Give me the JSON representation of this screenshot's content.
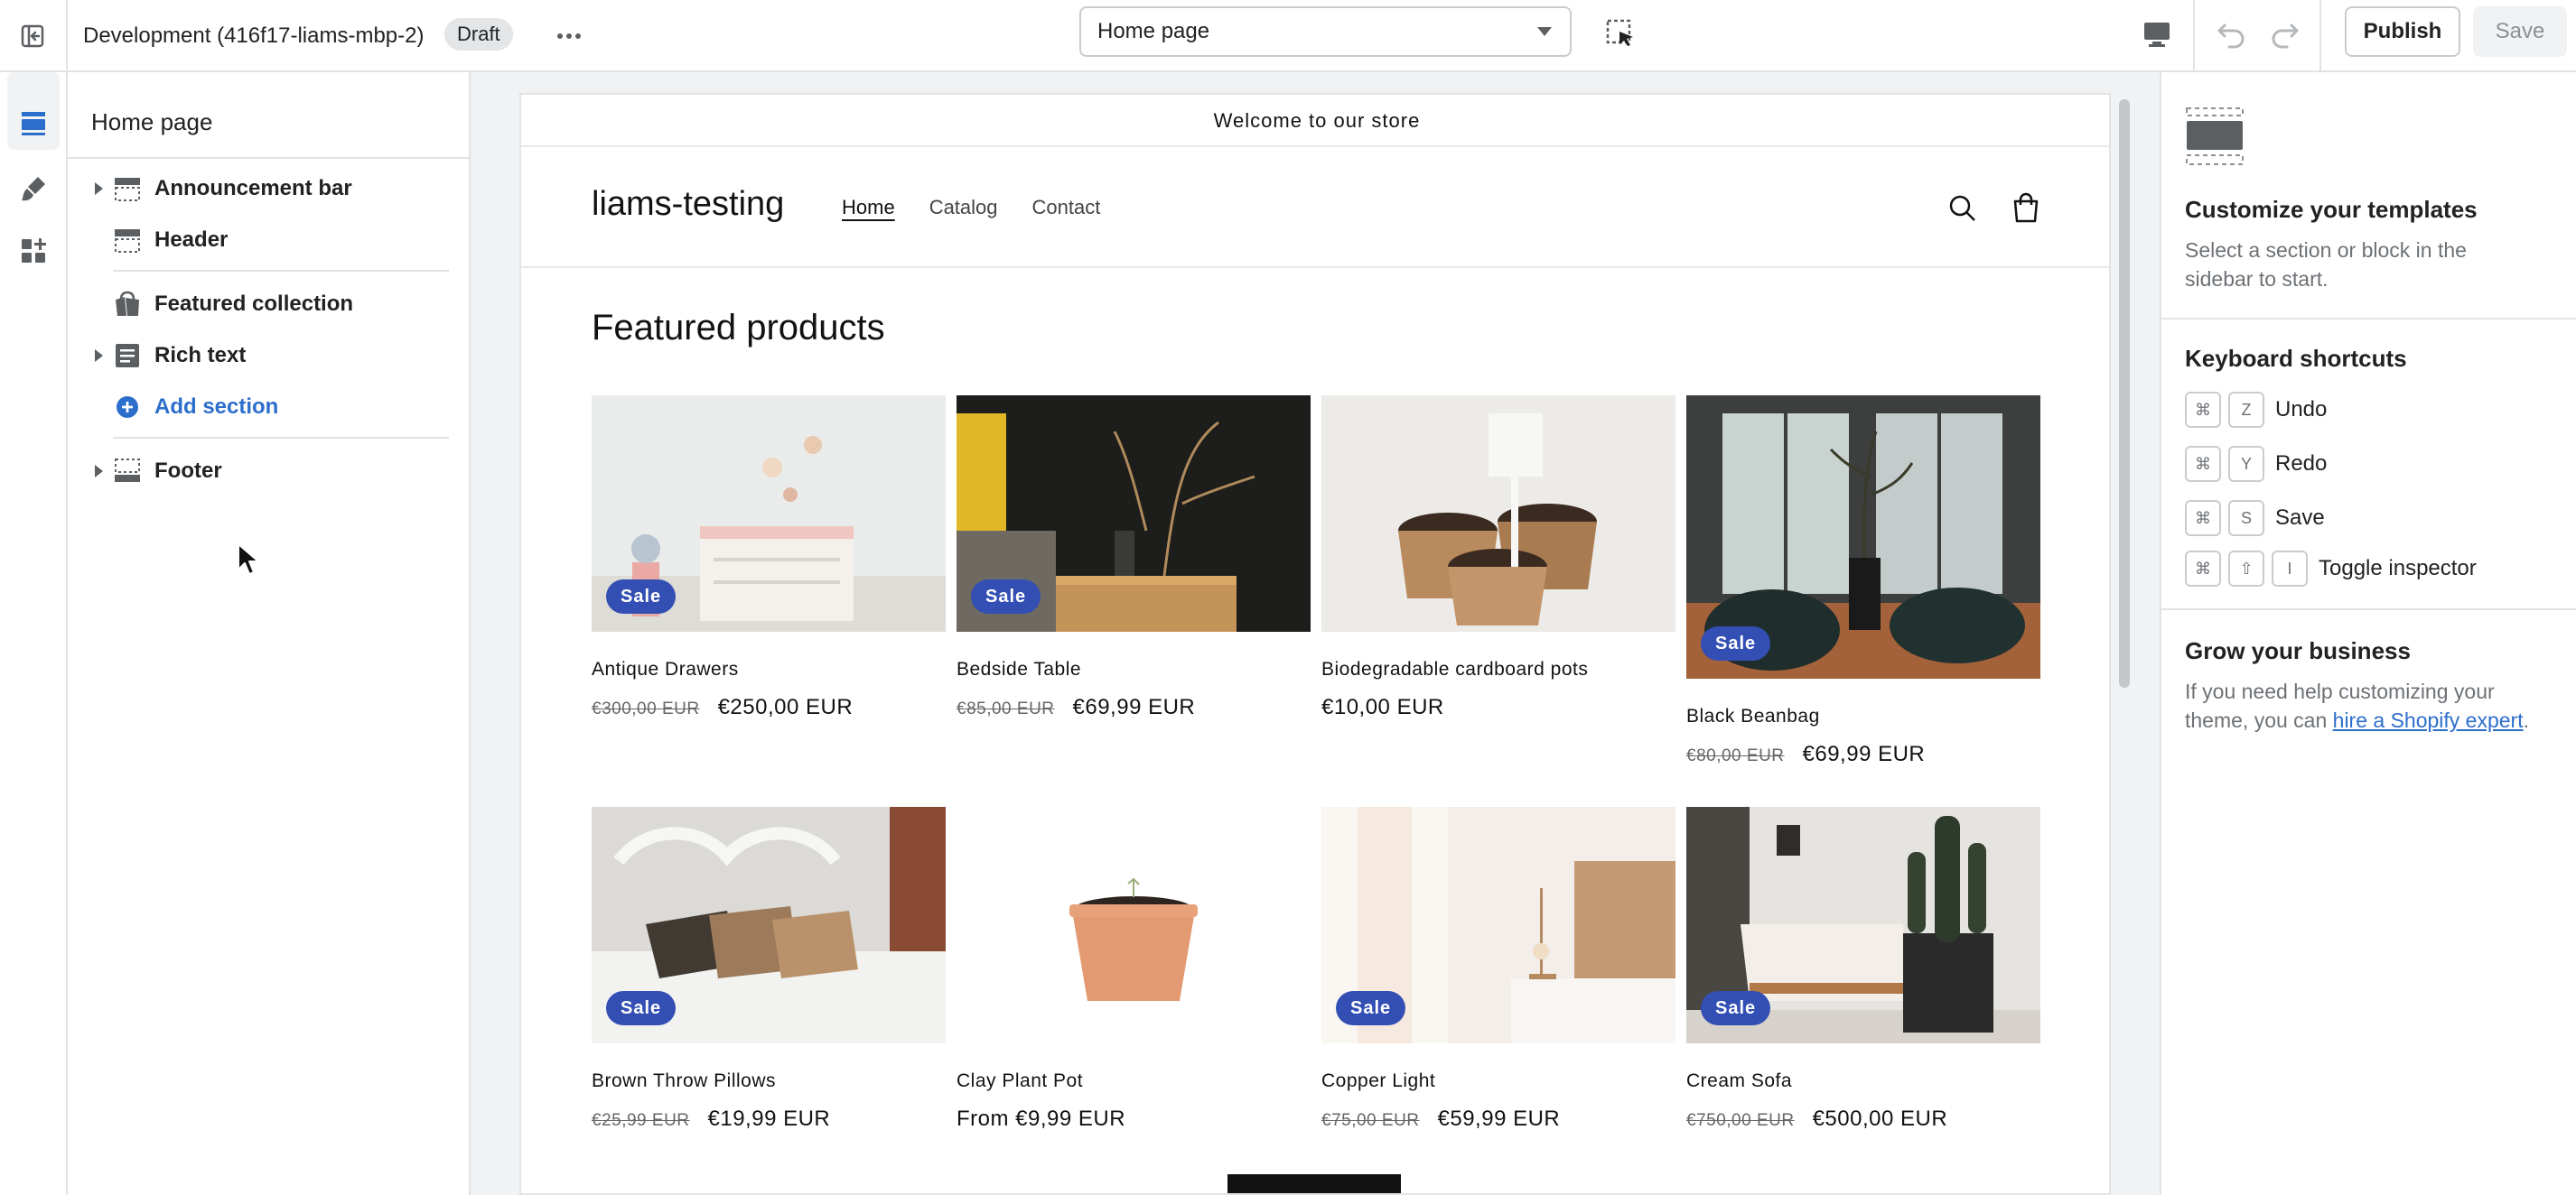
{
  "topbar": {
    "store": "Development (416f17-liams-mbp-2)",
    "status_badge": "Draft",
    "template_select": "Home page",
    "publish_label": "Publish",
    "save_label": "Save"
  },
  "sidebar": {
    "title": "Home page",
    "items": [
      {
        "label": "Announcement bar"
      },
      {
        "label": "Header"
      },
      {
        "label": "Featured collection"
      },
      {
        "label": "Rich text"
      },
      {
        "label": "Add section"
      },
      {
        "label": "Footer"
      }
    ]
  },
  "preview": {
    "announcement": "Welcome to our store",
    "store_name": "liams-testing",
    "nav": [
      "Home",
      "Catalog",
      "Contact"
    ],
    "section_title": "Featured products",
    "sale_badge": "Sale",
    "products": [
      {
        "name": "Antique Drawers",
        "old_price": "€300,00 EUR",
        "price": "€250,00 EUR",
        "sale": true
      },
      {
        "name": "Bedside Table",
        "old_price": "€85,00 EUR",
        "price": "€69,99 EUR",
        "sale": true
      },
      {
        "name": "Biodegradable cardboard pots",
        "old_price": "",
        "price": "€10,00 EUR",
        "sale": false
      },
      {
        "name": "Black Beanbag",
        "old_price": "€80,00 EUR",
        "price": "€69,99 EUR",
        "sale": true
      },
      {
        "name": "Brown Throw Pillows",
        "old_price": "€25,99 EUR",
        "price": "€19,99 EUR",
        "sale": true
      },
      {
        "name": "Clay Plant Pot",
        "old_price": "",
        "price": "From €9,99 EUR",
        "sale": false
      },
      {
        "name": "Copper Light",
        "old_price": "€75,00 EUR",
        "price": "€59,99 EUR",
        "sale": true
      },
      {
        "name": "Cream Sofa",
        "old_price": "€750,00 EUR",
        "price": "€500,00 EUR",
        "sale": true
      }
    ]
  },
  "right_panel": {
    "customize_title": "Customize your templates",
    "customize_text": "Select a section or block in the sidebar to start.",
    "shortcuts_title": "Keyboard shortcuts",
    "shortcuts": [
      {
        "keys": [
          "⌘",
          "Z"
        ],
        "label": "Undo"
      },
      {
        "keys": [
          "⌘",
          "Y"
        ],
        "label": "Redo"
      },
      {
        "keys": [
          "⌘",
          "S"
        ],
        "label": "Save"
      },
      {
        "keys": [
          "⌘",
          "⇧",
          "I"
        ],
        "label": "Toggle inspector"
      }
    ],
    "grow_title": "Grow your business",
    "grow_text_before": "If you need help customizing your theme, you can ",
    "grow_link": "hire a Shopify expert",
    "grow_text_after": "."
  },
  "colors": {
    "sale_badge": "#334fb4",
    "link": "#2c6ecb",
    "border": "#e1e3e5"
  }
}
